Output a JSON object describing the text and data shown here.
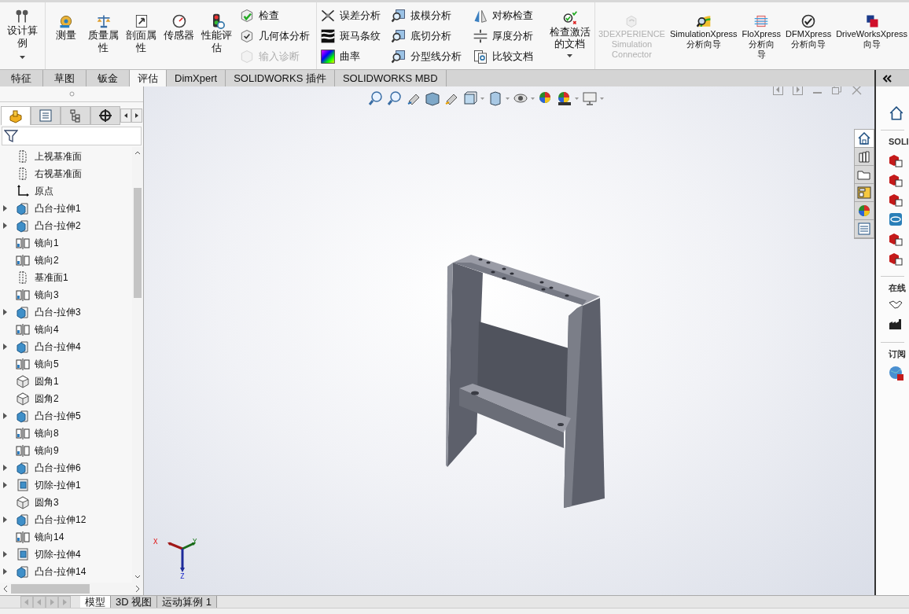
{
  "ribbon": {
    "design_study": {
      "lines": [
        "设计算",
        "例"
      ]
    },
    "tools": [
      {
        "lines": [
          "测量"
        ]
      },
      {
        "lines": [
          "质量属",
          "性"
        ]
      },
      {
        "lines": [
          "剖面属",
          "性"
        ]
      },
      {
        "lines": [
          "传感器"
        ]
      },
      {
        "lines": [
          "性能评",
          "估"
        ]
      }
    ],
    "check_column": [
      {
        "label": "检查",
        "disabled": false
      },
      {
        "label": "几何体分析",
        "disabled": false
      },
      {
        "label": "输入诊断",
        "disabled": true
      }
    ],
    "analysis_columns": [
      [
        {
          "label": "误差分析"
        },
        {
          "label": "斑马条纹"
        },
        {
          "label": "曲率"
        }
      ],
      [
        {
          "label": "拔模分析"
        },
        {
          "label": "底切分析"
        },
        {
          "label": "分型线分析"
        }
      ],
      [
        {
          "label": "对称检查"
        },
        {
          "label": "厚度分析"
        },
        {
          "label": "比较文档"
        }
      ]
    ],
    "check_active": {
      "lines": [
        "检查激活",
        "的文档"
      ]
    },
    "add_ins": [
      {
        "lines": [
          "3DEXPERIENCE",
          "Simulation",
          "Connector"
        ],
        "disabled": true
      },
      {
        "lines": [
          "SimulationXpress",
          "分析向导"
        ],
        "disabled": false
      },
      {
        "lines": [
          "FloXpress",
          "分析向",
          "导"
        ],
        "disabled": false
      },
      {
        "lines": [
          "DFMXpress",
          "分析向导"
        ],
        "disabled": false
      },
      {
        "lines": [
          "DriveWorksXpress",
          "向导"
        ],
        "disabled": false
      }
    ]
  },
  "tabs": [
    {
      "label": "特征",
      "selected": false
    },
    {
      "label": "草图",
      "selected": false
    },
    {
      "label": "钣金",
      "selected": false
    },
    {
      "label": "评估",
      "selected": true
    },
    {
      "label": "DimXpert",
      "selected": false
    },
    {
      "label": "SOLIDWORKS 插件",
      "selected": false
    },
    {
      "label": "SOLIDWORKS MBD",
      "selected": false
    }
  ],
  "feature_tree": {
    "panel_tabs": [
      {
        "selected": true
      },
      {
        "selected": false
      },
      {
        "selected": false
      },
      {
        "selected": false
      }
    ],
    "items": [
      {
        "label": "上视基准面",
        "kind": "plane",
        "expandable": false
      },
      {
        "label": "右视基准面",
        "kind": "plane",
        "expandable": false
      },
      {
        "label": "原点",
        "kind": "origin",
        "expandable": false
      },
      {
        "label": "凸台-拉伸1",
        "kind": "boss",
        "expandable": true
      },
      {
        "label": "凸台-拉伸2",
        "kind": "boss",
        "expandable": true
      },
      {
        "label": "镜向1",
        "kind": "mirror",
        "expandable": false
      },
      {
        "label": "镜向2",
        "kind": "mirror",
        "expandable": false
      },
      {
        "label": "基准面1",
        "kind": "plane",
        "expandable": false
      },
      {
        "label": "镜向3",
        "kind": "mirror",
        "expandable": false
      },
      {
        "label": "凸台-拉伸3",
        "kind": "boss",
        "expandable": true
      },
      {
        "label": "镜向4",
        "kind": "mirror",
        "expandable": false
      },
      {
        "label": "凸台-拉伸4",
        "kind": "boss",
        "expandable": true
      },
      {
        "label": "镜向5",
        "kind": "mirror",
        "expandable": false
      },
      {
        "label": "圆角1",
        "kind": "fillet",
        "expandable": false
      },
      {
        "label": "圆角2",
        "kind": "fillet",
        "expandable": false
      },
      {
        "label": "凸台-拉伸5",
        "kind": "boss",
        "expandable": true
      },
      {
        "label": "镜向8",
        "kind": "mirror",
        "expandable": false
      },
      {
        "label": "镜向9",
        "kind": "mirror",
        "expandable": false
      },
      {
        "label": "凸台-拉伸6",
        "kind": "boss",
        "expandable": true
      },
      {
        "label": "切除-拉伸1",
        "kind": "cut",
        "expandable": true
      },
      {
        "label": "圆角3",
        "kind": "fillet",
        "expandable": false
      },
      {
        "label": "凸台-拉伸12",
        "kind": "boss",
        "expandable": true
      },
      {
        "label": "镜向14",
        "kind": "mirror",
        "expandable": false
      },
      {
        "label": "切除-拉伸4",
        "kind": "cut",
        "expandable": true
      },
      {
        "label": "凸台-拉伸14",
        "kind": "boss",
        "expandable": true
      }
    ]
  },
  "triad": {
    "labels": [
      "X",
      "Y",
      "Z"
    ]
  },
  "task_pane_tabs": [
    {
      "selected": true
    },
    {
      "selected": false
    },
    {
      "selected": false
    },
    {
      "selected": false
    },
    {
      "selected": false
    },
    {
      "selected": false
    }
  ],
  "task_pane": {
    "headings": [
      "SOLI",
      "在线",
      "订阅"
    ]
  },
  "bottom_tabs": [
    {
      "label": "模型",
      "selected": true
    },
    {
      "label": "3D 视图",
      "selected": false
    },
    {
      "label": "运动算例 1",
      "selected": false
    }
  ]
}
